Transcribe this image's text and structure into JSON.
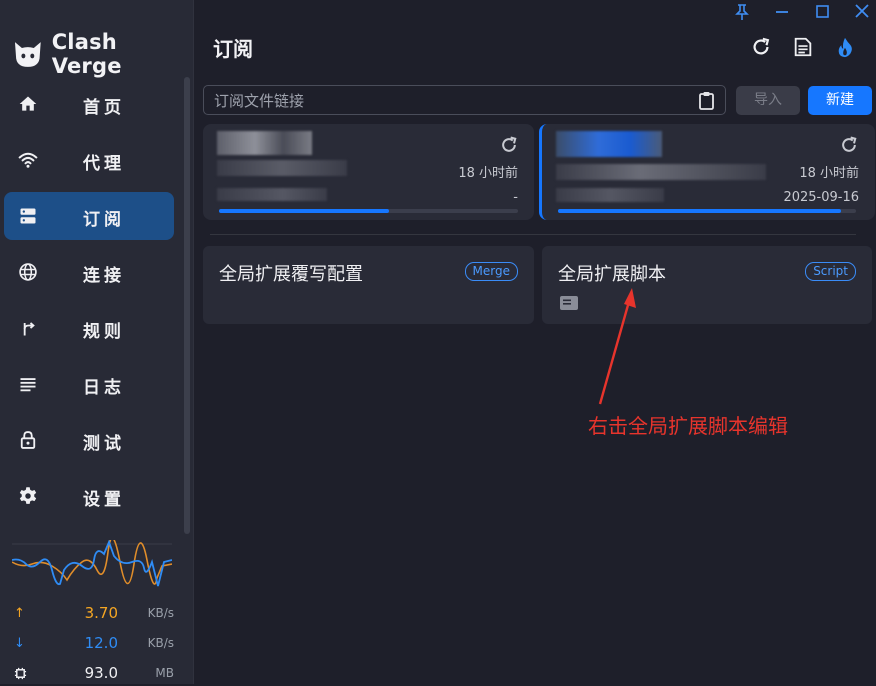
{
  "app": {
    "name": "Clash Verge"
  },
  "sidebar": {
    "items": [
      {
        "key": "home",
        "label": "首页",
        "icon": "home-icon",
        "active": false
      },
      {
        "key": "proxies",
        "label": "代理",
        "icon": "wifi-icon",
        "active": false
      },
      {
        "key": "profiles",
        "label": "订阅",
        "icon": "dns-icon",
        "active": true
      },
      {
        "key": "connections",
        "label": "连接",
        "icon": "globe-icon",
        "active": false
      },
      {
        "key": "rules",
        "label": "规则",
        "icon": "fork-right-icon",
        "active": false
      },
      {
        "key": "logs",
        "label": "日志",
        "icon": "list-icon",
        "active": false
      },
      {
        "key": "test",
        "label": "测试",
        "icon": "lock-icon",
        "active": false
      },
      {
        "key": "settings",
        "label": "设置",
        "icon": "gear-icon",
        "active": false
      }
    ],
    "traffic": {
      "upload": {
        "value": "3.70",
        "unit": "KB/s",
        "color": "#f5a623"
      },
      "download": {
        "value": "12.0",
        "unit": "KB/s",
        "color": "#2f8cf5"
      },
      "memory": {
        "value": "93.0",
        "unit": "MB"
      }
    }
  },
  "header": {
    "title": "订阅"
  },
  "import_bar": {
    "placeholder": "订阅文件链接",
    "import_label": "导入",
    "new_label": "新建"
  },
  "profiles": [
    {
      "updated": "18 小时前",
      "expire": "-",
      "usage_percent": 57,
      "selected": false
    },
    {
      "updated": "18 小时前",
      "expire": "2025-09-16",
      "usage_percent": 95,
      "selected": true
    }
  ],
  "global": [
    {
      "title": "全局扩展覆写配置",
      "badge": "Merge"
    },
    {
      "title": "全局扩展脚本",
      "badge": "Script"
    }
  ],
  "annotation": {
    "text": "右击全局扩展脚本编辑",
    "color": "#e7342c"
  },
  "colors": {
    "accent": "#1677ff",
    "sidebar_bg": "#282a36",
    "main_bg": "#1e1f2a",
    "card_bg": "#292b37"
  }
}
